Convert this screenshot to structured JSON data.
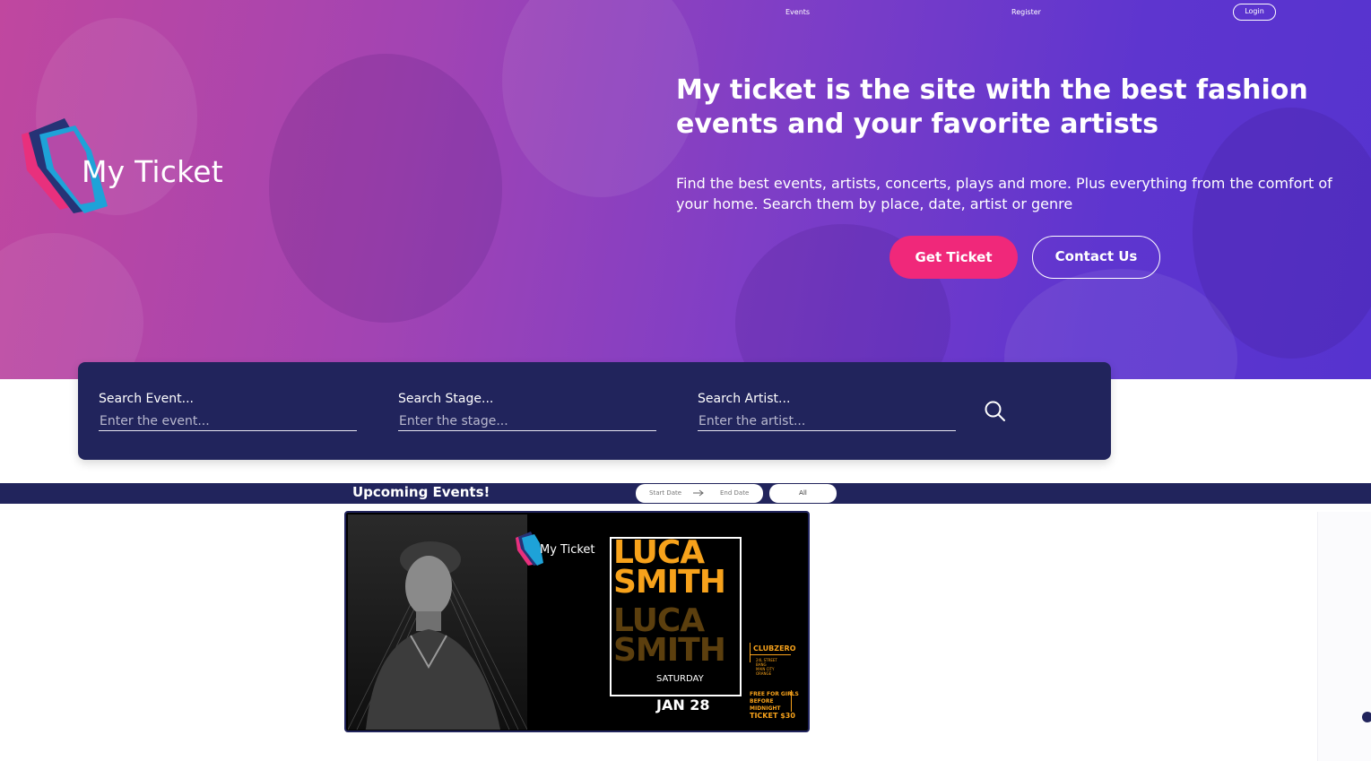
{
  "nav": {
    "events": "Events",
    "register": "Register",
    "login": "Login"
  },
  "brand": {
    "name": "My Ticket"
  },
  "hero": {
    "title": "My ticket is the site with the best fashion events and your favorite artists",
    "subtitle": "Find the best events, artists, concerts, plays and more. Plus everything from the comfort of your home. Search them by place, date, artist or genre",
    "get_ticket": "Get Ticket",
    "contact_us": "Contact Us"
  },
  "search": {
    "event": {
      "label": "Search Event...",
      "placeholder": "Enter the event..."
    },
    "stage": {
      "label": "Search Stage...",
      "placeholder": "Enter the stage..."
    },
    "artist": {
      "label": "Search Artist...",
      "placeholder": "Enter the artist..."
    },
    "icon": "search-icon"
  },
  "upcoming": {
    "title": "Upcoming Events!",
    "start_date": "Start Date",
    "end_date": "End Date",
    "filter": "All"
  },
  "event_card": {
    "brand": "My Ticket",
    "artist_line1": "LUCA",
    "artist_line2": "SMITH",
    "day": "SATURDAY",
    "date": "JAN 28",
    "venue": "CLUBZERO",
    "address": [
      "24L STREET",
      "BANG",
      "MAIN CITY",
      "ORANGE"
    ],
    "promo": [
      "FREE FOR GIRLS",
      "BEFORE",
      "MIDNIGHT"
    ],
    "price": "TICKET $30"
  },
  "colors": {
    "navy": "#21245c",
    "pink": "#f0287a",
    "orange": "#f7a21b"
  }
}
